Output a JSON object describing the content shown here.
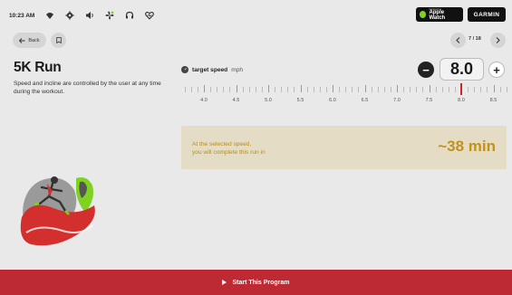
{
  "status_bar": {
    "time": "10:23 AM",
    "icons": [
      "wifi-icon",
      "gear-icon",
      "volume-icon",
      "fan-icon",
      "headphones-icon",
      "heart-icon"
    ]
  },
  "badges": {
    "apple_watch_small": "Connect to",
    "apple_watch_label": "Apple Watch",
    "garmin_label": "GARMIN"
  },
  "nav": {
    "back_label": "Back",
    "page_indicator": "7 / 18"
  },
  "program": {
    "title": "5K Run",
    "description": "Speed and incline are controlled by the user at any time during the workout."
  },
  "speed": {
    "label": "target speed",
    "unit": "mph",
    "value": "8.0",
    "minus_label": "−",
    "plus_label": "+",
    "ruler_labels": [
      "4.0",
      "4.5",
      "5.0",
      "5.5",
      "6.0",
      "6.5",
      "7.0",
      "7.5",
      "8.0",
      "8.5"
    ],
    "selected_speed": 8.0
  },
  "estimate": {
    "message_line1": "At the selected speed,",
    "message_line2": "you will complete this run in",
    "value": "~38 min"
  },
  "footer": {
    "start_label": "Start This Program"
  },
  "colors": {
    "accent_red": "#be2a33",
    "gold": "#c69114",
    "card_bg": "#e4dcc4"
  }
}
